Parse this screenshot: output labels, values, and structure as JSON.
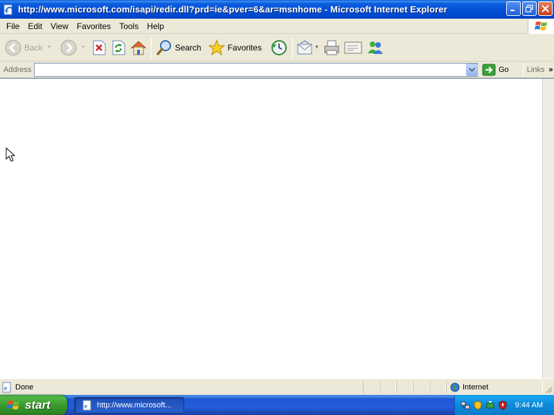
{
  "window": {
    "title": "http://www.microsoft.com/isapi/redir.dll?prd=ie&pver=6&ar=msnhome - Microsoft Internet Explorer"
  },
  "menu": [
    "File",
    "Edit",
    "View",
    "Favorites",
    "Tools",
    "Help"
  ],
  "toolbar": {
    "back_label": "Back",
    "search_label": "Search",
    "favorites_label": "Favorites"
  },
  "address": {
    "label": "Address",
    "value": "",
    "go_label": "Go",
    "links_label": "Links"
  },
  "status": {
    "text": "Done",
    "zone": "Internet"
  },
  "taskbar": {
    "start_label": "start",
    "task_label": "http://www.microsoft...",
    "clock": "9:44 AM"
  },
  "colors": {
    "titlebar": "#0551d6",
    "taskbar": "#245edb",
    "start": "#3a9a30"
  }
}
